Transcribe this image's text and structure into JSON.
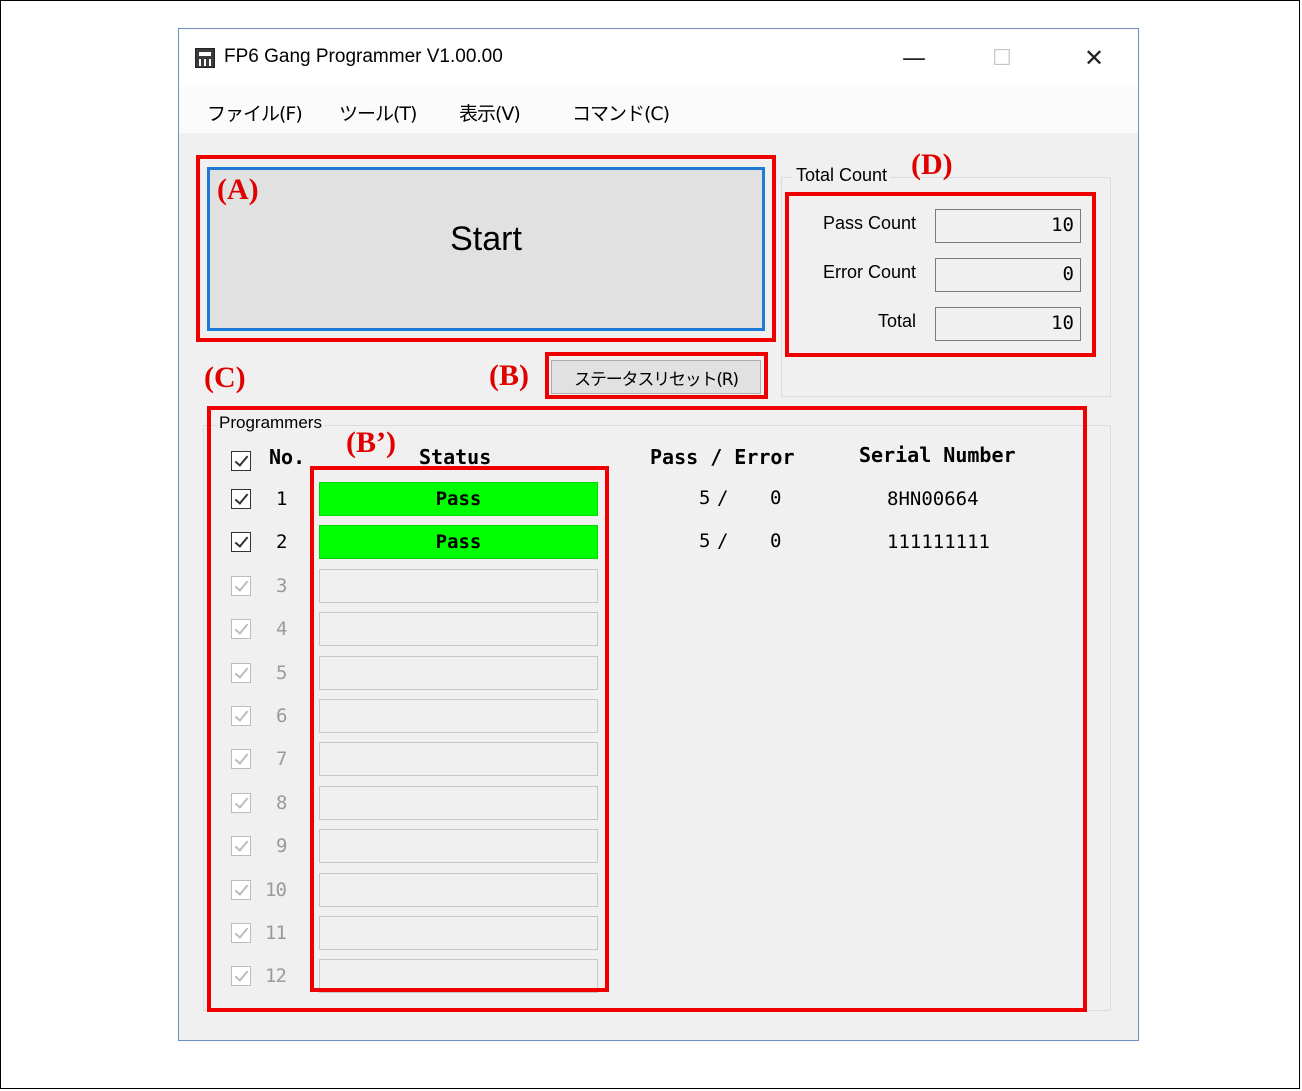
{
  "window": {
    "title": "FP6 Gang Programmer V1.00.00",
    "controls": {
      "minimize": "—",
      "maximize": "☐",
      "close": "✕"
    }
  },
  "menu": [
    "ファイル(F)",
    "ツール(T)",
    "表示(V)",
    "コマンド(C)"
  ],
  "start_button": {
    "label": "Start"
  },
  "reset_button": {
    "label": "ステータスリセット(R)"
  },
  "total_count": {
    "group_label": "Total Count",
    "pass_label": "Pass Count",
    "pass_value": "10",
    "error_label": "Error Count",
    "error_value": "0",
    "total_label": "Total",
    "total_value": "10"
  },
  "programmers": {
    "group_label": "Programmers",
    "headers": {
      "no": "No.",
      "status": "Status",
      "pass_error": "Pass / Error",
      "serial": "Serial Number"
    },
    "rows": [
      {
        "no": "1",
        "status": "Pass",
        "pass": "5",
        "error": "0",
        "serial": "8HN00664"
      },
      {
        "no": "2",
        "status": "Pass",
        "pass": "5",
        "error": "0",
        "serial": "111111111"
      },
      {
        "no": "3"
      },
      {
        "no": "4"
      },
      {
        "no": "5"
      },
      {
        "no": "6"
      },
      {
        "no": "7"
      },
      {
        "no": "8"
      },
      {
        "no": "9"
      },
      {
        "no": "10"
      },
      {
        "no": "11"
      },
      {
        "no": "12"
      }
    ]
  },
  "annotations": {
    "A": "(A)",
    "B": "(B)",
    "B_prime": "(B’)",
    "C": "(C)",
    "D": "(D)"
  },
  "colors": {
    "annotation": "#ee0000",
    "pass": "#00ff00",
    "focus": "#1e7ad4"
  }
}
